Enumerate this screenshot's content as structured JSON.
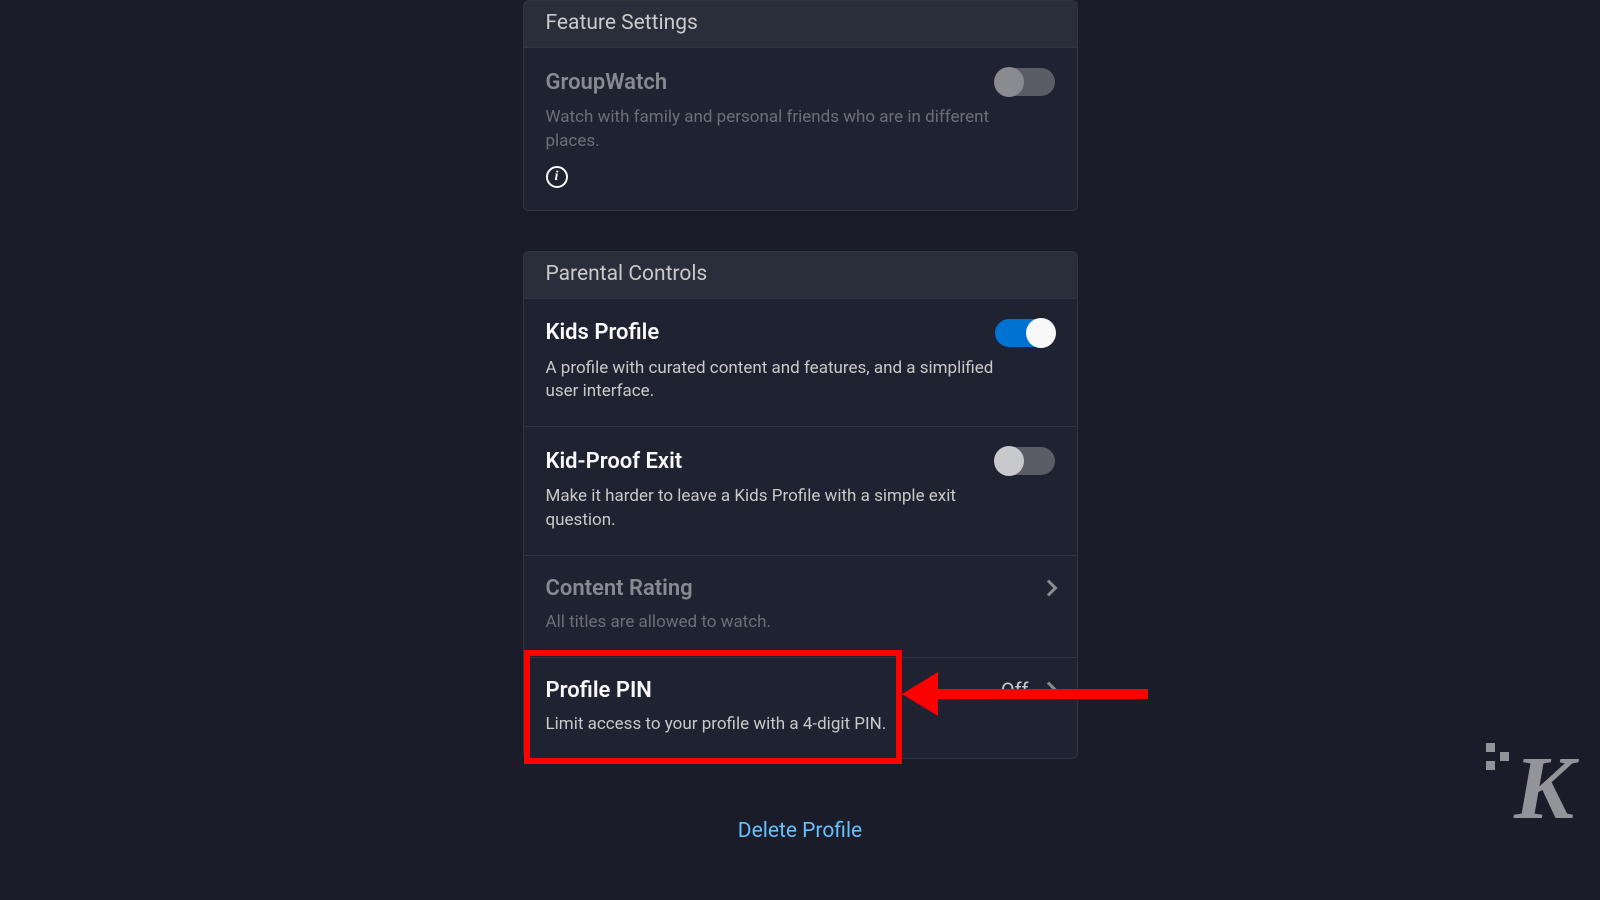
{
  "feature_settings": {
    "header": "Feature Settings",
    "groupwatch": {
      "title": "GroupWatch",
      "desc": "Watch with family and personal friends who are in different places.",
      "enabled": false
    }
  },
  "parental_controls": {
    "header": "Parental Controls",
    "kids_profile": {
      "title": "Kids Profile",
      "desc": "A profile with curated content and features, and a simplified user interface.",
      "enabled": true
    },
    "kid_proof_exit": {
      "title": "Kid-Proof Exit",
      "desc": "Make it harder to leave a Kids Profile with a simple exit question.",
      "enabled": false
    },
    "content_rating": {
      "title": "Content Rating",
      "desc": "All titles are allowed to watch."
    },
    "profile_pin": {
      "title": "Profile PIN",
      "desc": "Limit access to your profile with a 4-digit PIN.",
      "value": "Off"
    }
  },
  "delete_profile_label": "Delete Profile",
  "watermark": "K"
}
